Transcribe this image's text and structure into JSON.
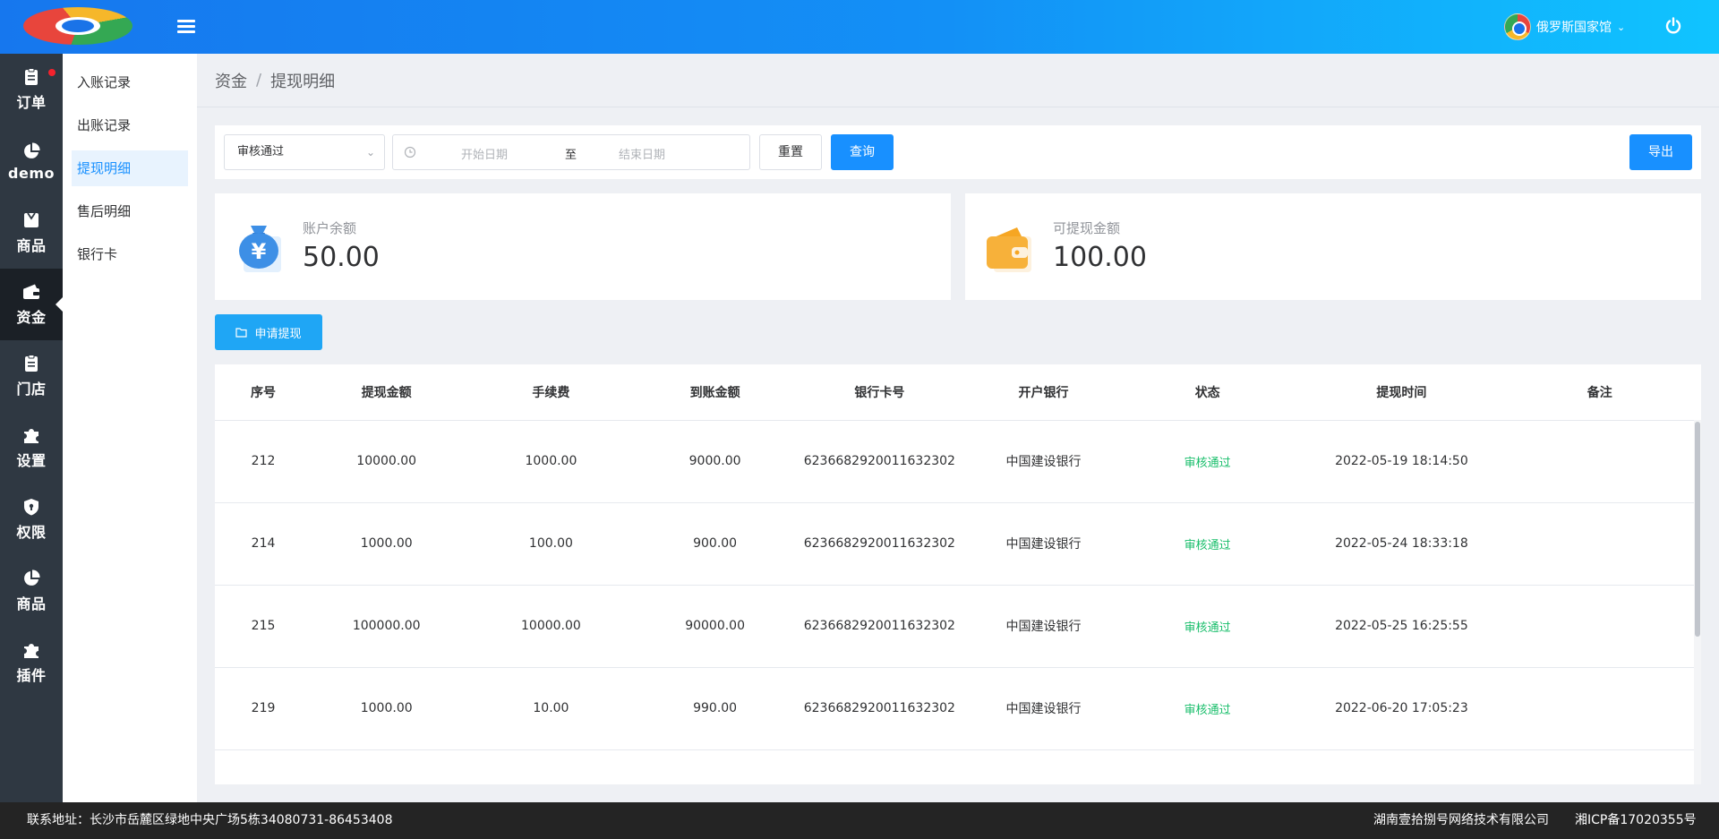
{
  "header": {
    "user_name": "俄罗斯国家馆",
    "colors": {
      "gradient_start": "#1677ee",
      "gradient_end": "#10c4ff"
    }
  },
  "sidebar": {
    "items": [
      {
        "label": "订单",
        "icon": "clipboard-icon",
        "badge": true
      },
      {
        "label": "demo",
        "icon": "pie-chart-icon"
      },
      {
        "label": "商品",
        "icon": "box-icon"
      },
      {
        "label": "资金",
        "icon": "wallet-icon",
        "active": true
      },
      {
        "label": "门店",
        "icon": "clipboard-icon"
      },
      {
        "label": "设置",
        "icon": "puzzle-icon"
      },
      {
        "label": "权限",
        "icon": "shield-icon"
      },
      {
        "label": "商品",
        "icon": "pie-chart-icon"
      },
      {
        "label": "插件",
        "icon": "puzzle-icon"
      }
    ]
  },
  "subnav": {
    "items": [
      "入账记录",
      "出账记录",
      "提现明细",
      "售后明细",
      "银行卡"
    ],
    "active_index": 2
  },
  "breadcrumb": {
    "parent": "资金",
    "separator": "/",
    "current": "提现明细"
  },
  "filters": {
    "status_selected": "审核通过",
    "start_placeholder": "开始日期",
    "range_separator": "至",
    "end_placeholder": "结束日期",
    "reset_label": "重置",
    "query_label": "查询",
    "export_label": "导出"
  },
  "stats": {
    "balance_label": "账户余额",
    "balance_value": "50.00",
    "withdrawable_label": "可提现金额",
    "withdrawable_value": "100.00"
  },
  "apply_label": "申请提现",
  "table": {
    "columns": [
      "序号",
      "提现金额",
      "手续费",
      "到账金额",
      "银行卡号",
      "开户银行",
      "状态",
      "提现时间",
      "备注"
    ],
    "rows": [
      [
        "212",
        "10000.00",
        "1000.00",
        "9000.00",
        "6236682920011632302",
        "中国建设银行",
        "审核通过",
        "2022-05-19 18:14:50",
        ""
      ],
      [
        "214",
        "1000.00",
        "100.00",
        "900.00",
        "6236682920011632302",
        "中国建设银行",
        "审核通过",
        "2022-05-24 18:33:18",
        ""
      ],
      [
        "215",
        "100000.00",
        "10000.00",
        "90000.00",
        "6236682920011632302",
        "中国建设银行",
        "审核通过",
        "2022-05-25 16:25:55",
        ""
      ],
      [
        "219",
        "1000.00",
        "10.00",
        "990.00",
        "6236682920011632302",
        "中国建设银行",
        "审核通过",
        "2022-06-20 17:05:23",
        ""
      ]
    ]
  },
  "footer": {
    "address": "联系地址：长沙市岳麓区绿地中央广场5栋34080731-86453408",
    "company": "湖南壹拾捌号网络技术有限公司",
    "icp": "湘ICP备17020355号"
  }
}
